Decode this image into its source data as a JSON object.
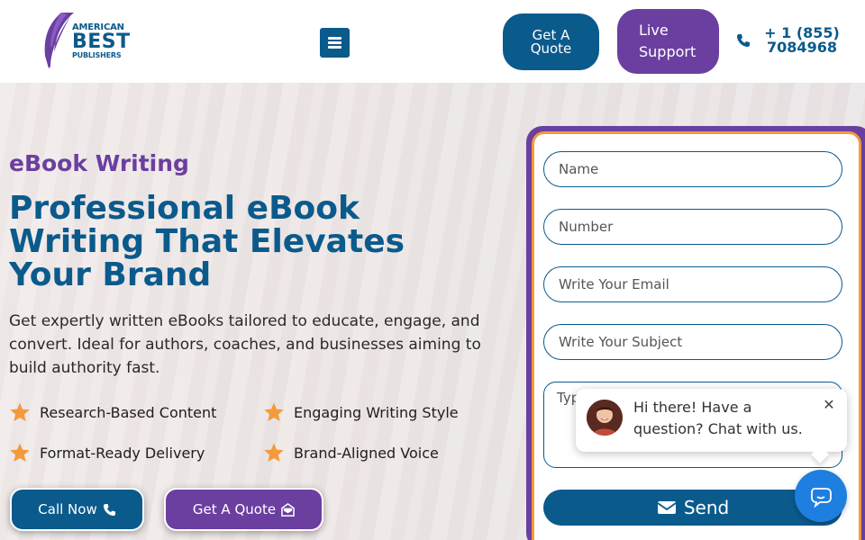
{
  "header": {
    "logo": {
      "line1": "AMERICAN",
      "line2": "BEST",
      "line3": "PUBLISHERS"
    },
    "quote_button": "Get A Quote",
    "live_support_button": "Live Support",
    "phone": "+ 1 (855) 7084968"
  },
  "hero": {
    "eyebrow": "eBook Writing",
    "headline": "Professional eBook Writing That Elevates Your Brand",
    "intro": "Get expertly written eBooks tailored to educate, engage, and convert. Ideal for authors, coaches, and businesses aiming to build authority fast.",
    "features": [
      "Research-Based Content",
      "Engaging Writing Style",
      "Format-Ready Delivery",
      "Brand-Aligned Voice"
    ],
    "call_button": "Call Now",
    "quote_button": "Get A Quote"
  },
  "form": {
    "name_placeholder": "Name",
    "number_placeholder": "Number",
    "email_placeholder": "Write Your Email",
    "subject_placeholder": "Write Your Subject",
    "message_placeholder": "Type",
    "send_button": "Send"
  },
  "chat": {
    "message": "Hi there! Have a question? Chat with us."
  },
  "colors": {
    "brand_blue": "#0b5a8c",
    "brand_purple": "#6b3fa0",
    "accent_orange": "#f39a3c",
    "chat_blue": "#1e7fe0"
  }
}
